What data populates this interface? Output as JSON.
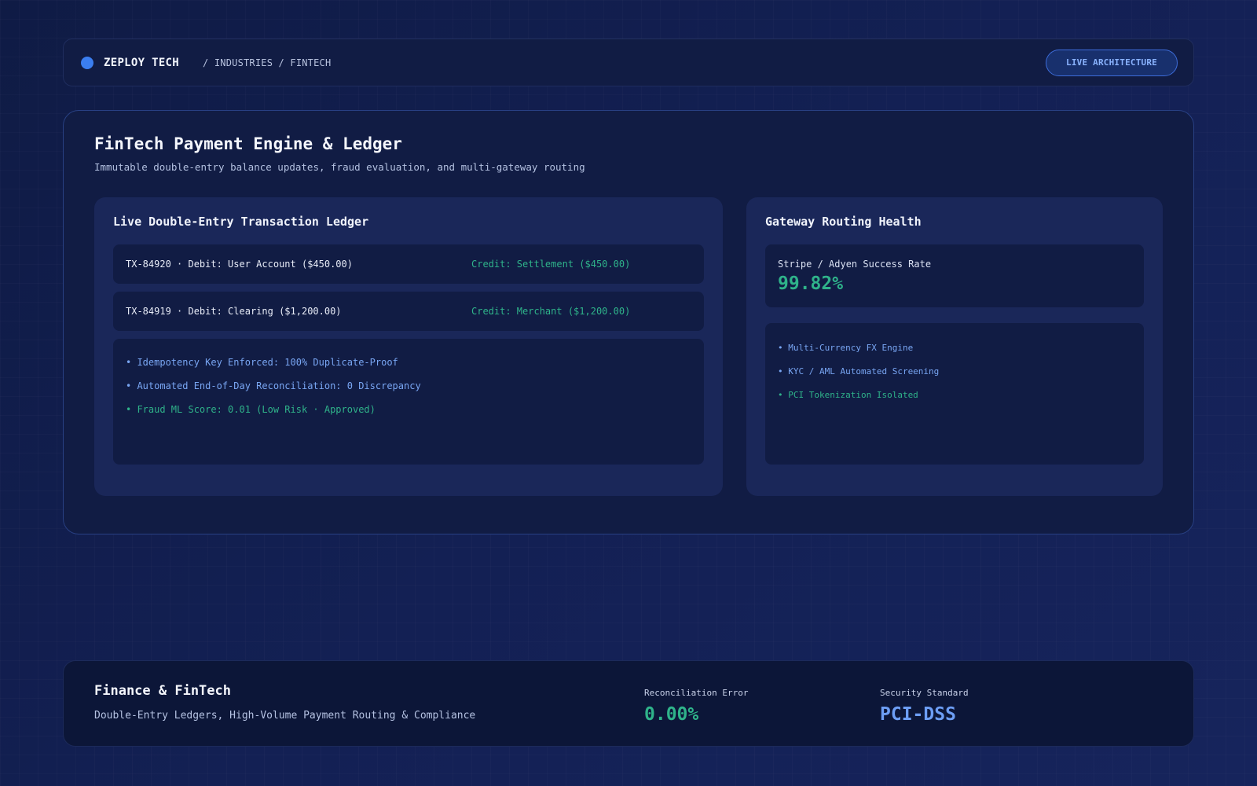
{
  "header": {
    "brand": "ZEPLOY TECH",
    "breadcrumb": "/ INDUSTRIES / FINTECH",
    "live_button": "LIVE ARCHITECTURE"
  },
  "main": {
    "title": "FinTech Payment Engine & Ledger",
    "subtitle": "Immutable double-entry balance updates, fraud evaluation, and multi-gateway routing",
    "ledger": {
      "title": "Live Double-Entry Transaction Ledger",
      "rows": [
        {
          "debit": "TX-84920 · Debit: User Account ($450.00)",
          "credit": "Credit: Settlement ($450.00)"
        },
        {
          "debit": "TX-84919 · Debit: Clearing ($1,200.00)",
          "credit": "Credit: Merchant ($1,200.00)"
        }
      ],
      "info": [
        "• Idempotency Key Enforced: 100% Duplicate-Proof",
        "• Automated End-of-Day Reconciliation: 0 Discrepancy",
        "• Fraud ML Score: 0.01 (Low Risk · Approved)"
      ]
    },
    "gateway": {
      "title": "Gateway Routing Health",
      "rate_label": "Stripe / Adyen Success Rate",
      "rate_value": "99.82%",
      "features": [
        "• Multi-Currency FX Engine",
        "• KYC / AML Automated Screening",
        "• PCI Tokenization Isolated"
      ]
    }
  },
  "footer": {
    "title": "Finance & FinTech",
    "subtitle": "Double-Entry Ledgers, High-Volume Payment Routing & Compliance",
    "metrics": [
      {
        "label": "Reconciliation Error",
        "value": "0.00%"
      },
      {
        "label": "Security Standard",
        "value": "PCI-DSS"
      }
    ]
  },
  "colors": {
    "accent_blue": "#3b7ef0",
    "success_green": "#2fb38a",
    "info_blue": "#79a6f3"
  }
}
